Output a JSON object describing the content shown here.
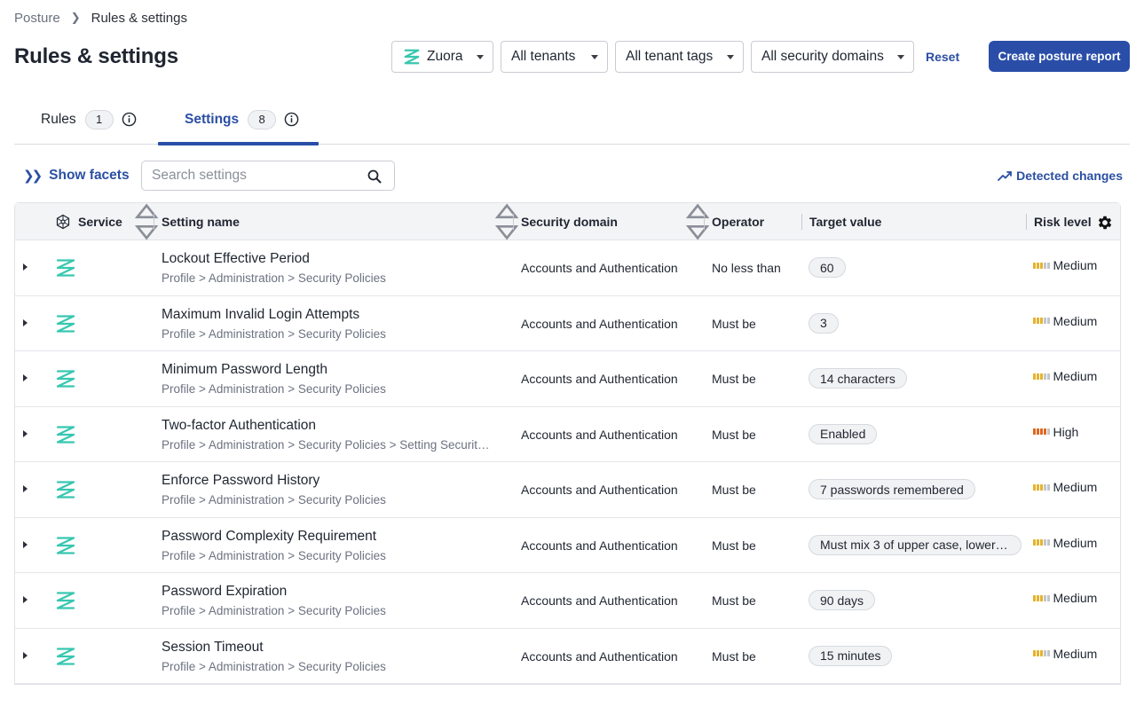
{
  "breadcrumb": {
    "root": "Posture",
    "current": "Rules & settings"
  },
  "page_title": "Rules & settings",
  "filters": {
    "service": "Zuora",
    "tenants": "All tenants",
    "tenant_tags": "All tenant tags",
    "security_domains": "All security domains"
  },
  "reset_label": "Reset",
  "create_label": "Create posture report",
  "tabs": [
    {
      "label": "Rules",
      "count": "1"
    },
    {
      "label": "Settings",
      "count": "8"
    }
  ],
  "toolbar": {
    "show_facets": "Show facets",
    "search_placeholder": "Search settings",
    "detected_changes": "Detected changes"
  },
  "columns": {
    "service": "Service",
    "setting_name": "Setting name",
    "security_domain": "Security domain",
    "operator": "Operator",
    "target_value": "Target value",
    "risk_level": "Risk level"
  },
  "colors": {
    "accent": "#2a4ea8",
    "zuora": "#38c7b0",
    "medium": "#e5b32b",
    "high": "#e0671f"
  },
  "rows": [
    {
      "name": "Lockout Effective Period",
      "path": "Profile > Administration > Security Policies",
      "domain": "Accounts and Authentication",
      "operator": "No less than",
      "target": "60",
      "risk": "Medium"
    },
    {
      "name": "Maximum Invalid Login Attempts",
      "path": "Profile > Administration > Security Policies",
      "domain": "Accounts and Authentication",
      "operator": "Must be",
      "target": "3",
      "risk": "Medium"
    },
    {
      "name": "Minimum Password Length",
      "path": "Profile > Administration > Security Policies",
      "domain": "Accounts and Authentication",
      "operator": "Must be",
      "target": "14 characters",
      "risk": "Medium"
    },
    {
      "name": "Two-factor Authentication",
      "path": "Profile > Administration > Security Policies > Setting Security P...",
      "domain": "Accounts and Authentication",
      "operator": "Must be",
      "target": "Enabled",
      "risk": "High"
    },
    {
      "name": "Enforce Password History",
      "path": "Profile > Administration > Security Policies",
      "domain": "Accounts and Authentication",
      "operator": "Must be",
      "target": "7 passwords remembered",
      "risk": "Medium"
    },
    {
      "name": "Password Complexity Requirement",
      "path": "Profile > Administration > Security Policies",
      "domain": "Accounts and Authentication",
      "operator": "Must be",
      "target": "Must mix 3 of upper case, lower ca...",
      "risk": "Medium"
    },
    {
      "name": "Password Expiration",
      "path": "Profile > Administration > Security Policies",
      "domain": "Accounts and Authentication",
      "operator": "Must be",
      "target": "90 days",
      "risk": "Medium"
    },
    {
      "name": "Session Timeout",
      "path": "Profile > Administration > Security Policies",
      "domain": "Accounts and Authentication",
      "operator": "Must be",
      "target": "15 minutes",
      "risk": "Medium"
    }
  ]
}
